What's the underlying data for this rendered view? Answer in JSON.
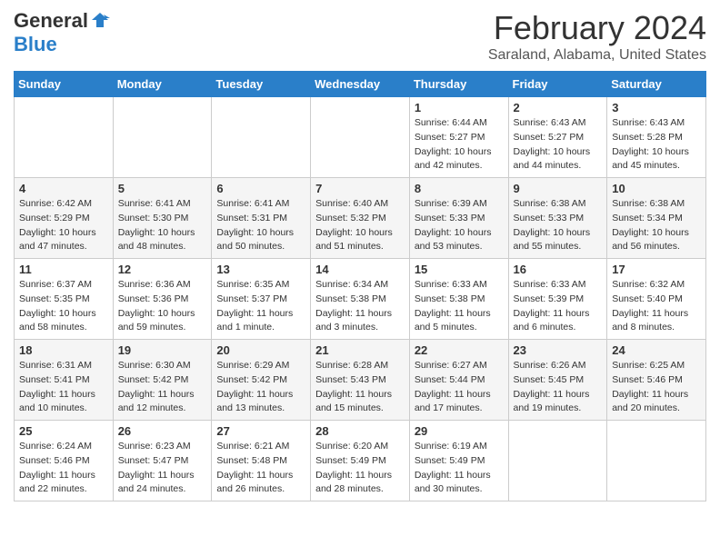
{
  "header": {
    "logo_general": "General",
    "logo_blue": "Blue",
    "month": "February 2024",
    "location": "Saraland, Alabama, United States"
  },
  "days_of_week": [
    "Sunday",
    "Monday",
    "Tuesday",
    "Wednesday",
    "Thursday",
    "Friday",
    "Saturday"
  ],
  "weeks": [
    [
      {
        "day": "",
        "info": ""
      },
      {
        "day": "",
        "info": ""
      },
      {
        "day": "",
        "info": ""
      },
      {
        "day": "",
        "info": ""
      },
      {
        "day": "1",
        "info": "Sunrise: 6:44 AM\nSunset: 5:27 PM\nDaylight: 10 hours\nand 42 minutes."
      },
      {
        "day": "2",
        "info": "Sunrise: 6:43 AM\nSunset: 5:27 PM\nDaylight: 10 hours\nand 44 minutes."
      },
      {
        "day": "3",
        "info": "Sunrise: 6:43 AM\nSunset: 5:28 PM\nDaylight: 10 hours\nand 45 minutes."
      }
    ],
    [
      {
        "day": "4",
        "info": "Sunrise: 6:42 AM\nSunset: 5:29 PM\nDaylight: 10 hours\nand 47 minutes."
      },
      {
        "day": "5",
        "info": "Sunrise: 6:41 AM\nSunset: 5:30 PM\nDaylight: 10 hours\nand 48 minutes."
      },
      {
        "day": "6",
        "info": "Sunrise: 6:41 AM\nSunset: 5:31 PM\nDaylight: 10 hours\nand 50 minutes."
      },
      {
        "day": "7",
        "info": "Sunrise: 6:40 AM\nSunset: 5:32 PM\nDaylight: 10 hours\nand 51 minutes."
      },
      {
        "day": "8",
        "info": "Sunrise: 6:39 AM\nSunset: 5:33 PM\nDaylight: 10 hours\nand 53 minutes."
      },
      {
        "day": "9",
        "info": "Sunrise: 6:38 AM\nSunset: 5:33 PM\nDaylight: 10 hours\nand 55 minutes."
      },
      {
        "day": "10",
        "info": "Sunrise: 6:38 AM\nSunset: 5:34 PM\nDaylight: 10 hours\nand 56 minutes."
      }
    ],
    [
      {
        "day": "11",
        "info": "Sunrise: 6:37 AM\nSunset: 5:35 PM\nDaylight: 10 hours\nand 58 minutes."
      },
      {
        "day": "12",
        "info": "Sunrise: 6:36 AM\nSunset: 5:36 PM\nDaylight: 10 hours\nand 59 minutes."
      },
      {
        "day": "13",
        "info": "Sunrise: 6:35 AM\nSunset: 5:37 PM\nDaylight: 11 hours\nand 1 minute."
      },
      {
        "day": "14",
        "info": "Sunrise: 6:34 AM\nSunset: 5:38 PM\nDaylight: 11 hours\nand 3 minutes."
      },
      {
        "day": "15",
        "info": "Sunrise: 6:33 AM\nSunset: 5:38 PM\nDaylight: 11 hours\nand 5 minutes."
      },
      {
        "day": "16",
        "info": "Sunrise: 6:33 AM\nSunset: 5:39 PM\nDaylight: 11 hours\nand 6 minutes."
      },
      {
        "day": "17",
        "info": "Sunrise: 6:32 AM\nSunset: 5:40 PM\nDaylight: 11 hours\nand 8 minutes."
      }
    ],
    [
      {
        "day": "18",
        "info": "Sunrise: 6:31 AM\nSunset: 5:41 PM\nDaylight: 11 hours\nand 10 minutes."
      },
      {
        "day": "19",
        "info": "Sunrise: 6:30 AM\nSunset: 5:42 PM\nDaylight: 11 hours\nand 12 minutes."
      },
      {
        "day": "20",
        "info": "Sunrise: 6:29 AM\nSunset: 5:42 PM\nDaylight: 11 hours\nand 13 minutes."
      },
      {
        "day": "21",
        "info": "Sunrise: 6:28 AM\nSunset: 5:43 PM\nDaylight: 11 hours\nand 15 minutes."
      },
      {
        "day": "22",
        "info": "Sunrise: 6:27 AM\nSunset: 5:44 PM\nDaylight: 11 hours\nand 17 minutes."
      },
      {
        "day": "23",
        "info": "Sunrise: 6:26 AM\nSunset: 5:45 PM\nDaylight: 11 hours\nand 19 minutes."
      },
      {
        "day": "24",
        "info": "Sunrise: 6:25 AM\nSunset: 5:46 PM\nDaylight: 11 hours\nand 20 minutes."
      }
    ],
    [
      {
        "day": "25",
        "info": "Sunrise: 6:24 AM\nSunset: 5:46 PM\nDaylight: 11 hours\nand 22 minutes."
      },
      {
        "day": "26",
        "info": "Sunrise: 6:23 AM\nSunset: 5:47 PM\nDaylight: 11 hours\nand 24 minutes."
      },
      {
        "day": "27",
        "info": "Sunrise: 6:21 AM\nSunset: 5:48 PM\nDaylight: 11 hours\nand 26 minutes."
      },
      {
        "day": "28",
        "info": "Sunrise: 6:20 AM\nSunset: 5:49 PM\nDaylight: 11 hours\nand 28 minutes."
      },
      {
        "day": "29",
        "info": "Sunrise: 6:19 AM\nSunset: 5:49 PM\nDaylight: 11 hours\nand 30 minutes."
      },
      {
        "day": "",
        "info": ""
      },
      {
        "day": "",
        "info": ""
      }
    ]
  ]
}
